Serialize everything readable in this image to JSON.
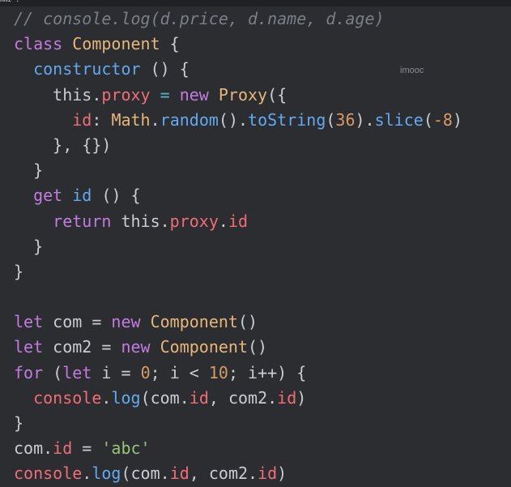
{
  "topbar": {
    "glyph": "mmz ."
  },
  "watermark": "imooc",
  "colors": {
    "background": "#2b2d31",
    "comment": "#7a7f88",
    "keyword": "#c37be0",
    "class": "#e7b77a",
    "function": "#62a9f0",
    "property": "#f06d78",
    "number": "#d69a66",
    "string": "#98c379",
    "text": "#c9ccd1"
  },
  "code": {
    "lines": [
      [
        {
          "t": "// console.log(d.price, d.name, d.age)",
          "c": "comment"
        }
      ],
      [
        {
          "t": "class",
          "c": "kw"
        },
        {
          "t": " ",
          "c": "plain"
        },
        {
          "t": "Component",
          "c": "cls"
        },
        {
          "t": " {",
          "c": "punc"
        }
      ],
      [
        {
          "t": "  ",
          "c": "plain"
        },
        {
          "t": "constructor",
          "c": "fn"
        },
        {
          "t": " () {",
          "c": "punc"
        }
      ],
      [
        {
          "t": "    this.",
          "c": "plain"
        },
        {
          "t": "proxy",
          "c": "prop"
        },
        {
          "t": " = ",
          "c": "op"
        },
        {
          "t": "new",
          "c": "kw"
        },
        {
          "t": " ",
          "c": "plain"
        },
        {
          "t": "Proxy",
          "c": "cls"
        },
        {
          "t": "({",
          "c": "punc"
        }
      ],
      [
        {
          "t": "      ",
          "c": "plain"
        },
        {
          "t": "id",
          "c": "prop"
        },
        {
          "t": ": ",
          "c": "punc"
        },
        {
          "t": "Math",
          "c": "cls"
        },
        {
          "t": ".",
          "c": "punc"
        },
        {
          "t": "random",
          "c": "fn"
        },
        {
          "t": "().",
          "c": "punc"
        },
        {
          "t": "toString",
          "c": "fn"
        },
        {
          "t": "(",
          "c": "punc"
        },
        {
          "t": "36",
          "c": "num"
        },
        {
          "t": ").",
          "c": "punc"
        },
        {
          "t": "slice",
          "c": "fn"
        },
        {
          "t": "(",
          "c": "punc"
        },
        {
          "t": "-8",
          "c": "num"
        },
        {
          "t": ")",
          "c": "punc"
        }
      ],
      [
        {
          "t": "    }, {})",
          "c": "punc"
        }
      ],
      [
        {
          "t": "  }",
          "c": "punc"
        }
      ],
      [
        {
          "t": "  ",
          "c": "plain"
        },
        {
          "t": "get",
          "c": "kw"
        },
        {
          "t": " ",
          "c": "plain"
        },
        {
          "t": "id",
          "c": "fn"
        },
        {
          "t": " () {",
          "c": "punc"
        }
      ],
      [
        {
          "t": "    ",
          "c": "plain"
        },
        {
          "t": "return",
          "c": "kw"
        },
        {
          "t": " this.",
          "c": "plain"
        },
        {
          "t": "proxy",
          "c": "prop"
        },
        {
          "t": ".",
          "c": "punc"
        },
        {
          "t": "id",
          "c": "prop"
        }
      ],
      [
        {
          "t": "  }",
          "c": "punc"
        }
      ],
      [
        {
          "t": "}",
          "c": "punc"
        }
      ],
      [
        {
          "t": "",
          "c": "plain"
        }
      ],
      [
        {
          "t": "let",
          "c": "kw"
        },
        {
          "t": " com = ",
          "c": "plain"
        },
        {
          "t": "new",
          "c": "kw"
        },
        {
          "t": " ",
          "c": "plain"
        },
        {
          "t": "Component",
          "c": "cls"
        },
        {
          "t": "()",
          "c": "punc"
        }
      ],
      [
        {
          "t": "let",
          "c": "kw"
        },
        {
          "t": " com2 = ",
          "c": "plain"
        },
        {
          "t": "new",
          "c": "kw"
        },
        {
          "t": " ",
          "c": "plain"
        },
        {
          "t": "Component",
          "c": "cls"
        },
        {
          "t": "()",
          "c": "punc"
        }
      ],
      [
        {
          "t": "for",
          "c": "kw"
        },
        {
          "t": " (",
          "c": "punc"
        },
        {
          "t": "let",
          "c": "kw"
        },
        {
          "t": " i = ",
          "c": "plain"
        },
        {
          "t": "0",
          "c": "num"
        },
        {
          "t": "; i < ",
          "c": "plain"
        },
        {
          "t": "10",
          "c": "num"
        },
        {
          "t": "; i++) {",
          "c": "plain"
        }
      ],
      [
        {
          "t": "  ",
          "c": "plain"
        },
        {
          "t": "console",
          "c": "prop"
        },
        {
          "t": ".",
          "c": "punc"
        },
        {
          "t": "log",
          "c": "fn"
        },
        {
          "t": "(com.",
          "c": "plain"
        },
        {
          "t": "id",
          "c": "prop"
        },
        {
          "t": ", com2.",
          "c": "plain"
        },
        {
          "t": "id",
          "c": "prop"
        },
        {
          "t": ")",
          "c": "punc"
        }
      ],
      [
        {
          "t": "}",
          "c": "punc"
        }
      ],
      [
        {
          "t": "com.",
          "c": "plain"
        },
        {
          "t": "id",
          "c": "prop"
        },
        {
          "t": " = ",
          "c": "plain"
        },
        {
          "t": "'abc'",
          "c": "str"
        }
      ],
      [
        {
          "t": "console",
          "c": "prop"
        },
        {
          "t": ".",
          "c": "punc"
        },
        {
          "t": "log",
          "c": "fn"
        },
        {
          "t": "(com.",
          "c": "plain"
        },
        {
          "t": "id",
          "c": "prop"
        },
        {
          "t": ", com2.",
          "c": "plain"
        },
        {
          "t": "id",
          "c": "prop"
        },
        {
          "t": ")",
          "c": "punc"
        }
      ]
    ]
  }
}
